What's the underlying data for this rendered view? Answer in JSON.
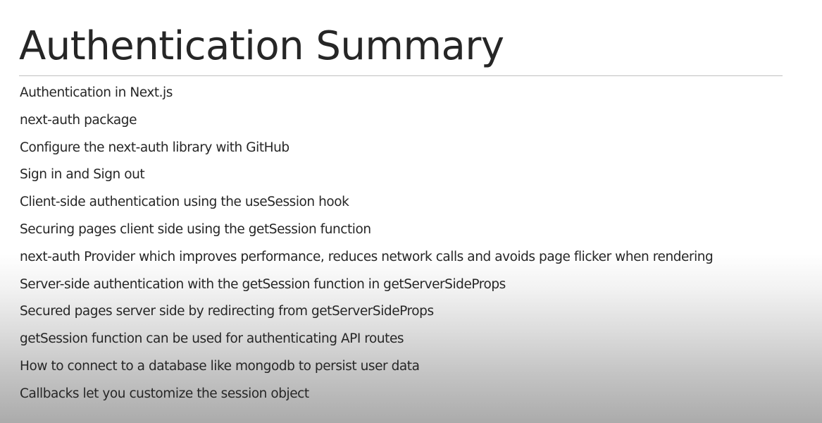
{
  "slide": {
    "title": "Authentication Summary",
    "items": [
      "Authentication in Next.js",
      "next-auth package",
      "Configure the next-auth library with GitHub",
      "Sign in and Sign out",
      "Client-side authentication using the useSession hook",
      "Securing pages client side using the getSession function",
      "next-auth Provider which improves performance, reduces network calls and avoids page flicker when rendering",
      "Server-side authentication with the getSession function in getServerSideProps",
      "Secured pages server side by redirecting from getServerSideProps",
      "getSession function can be used for authenticating API routes",
      "How to connect to a database like mongodb to persist user data",
      "Callbacks let you customize the session object"
    ]
  },
  "colors": {
    "text": "#262626",
    "rule": "#bfbfbf",
    "background_top": "#ffffff",
    "background_bottom": "#ababab"
  }
}
